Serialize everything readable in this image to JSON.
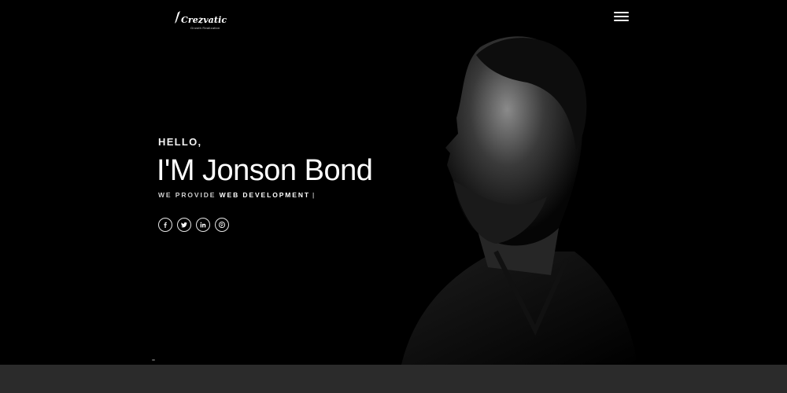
{
  "brand": {
    "name": "Crezvatic",
    "tagline": "Growth Realization"
  },
  "nav": {
    "menu_icon": "hamburger-menu-icon"
  },
  "hero": {
    "greeting": "HELLO,",
    "headline": "I'M Jonson Bond",
    "tagline_prefix": "WE PROVIDE ",
    "tagline_typed": "WEB DEVELOPMENT",
    "tagline_cursor": "|"
  },
  "socials": [
    {
      "icon": "facebook-icon"
    },
    {
      "icon": "twitter-icon"
    },
    {
      "icon": "linkedin-icon"
    },
    {
      "icon": "pinterest-icon"
    }
  ],
  "colors": {
    "background": "#000000",
    "bottom_bar": "#2b2b2b",
    "text": "#ffffff"
  }
}
